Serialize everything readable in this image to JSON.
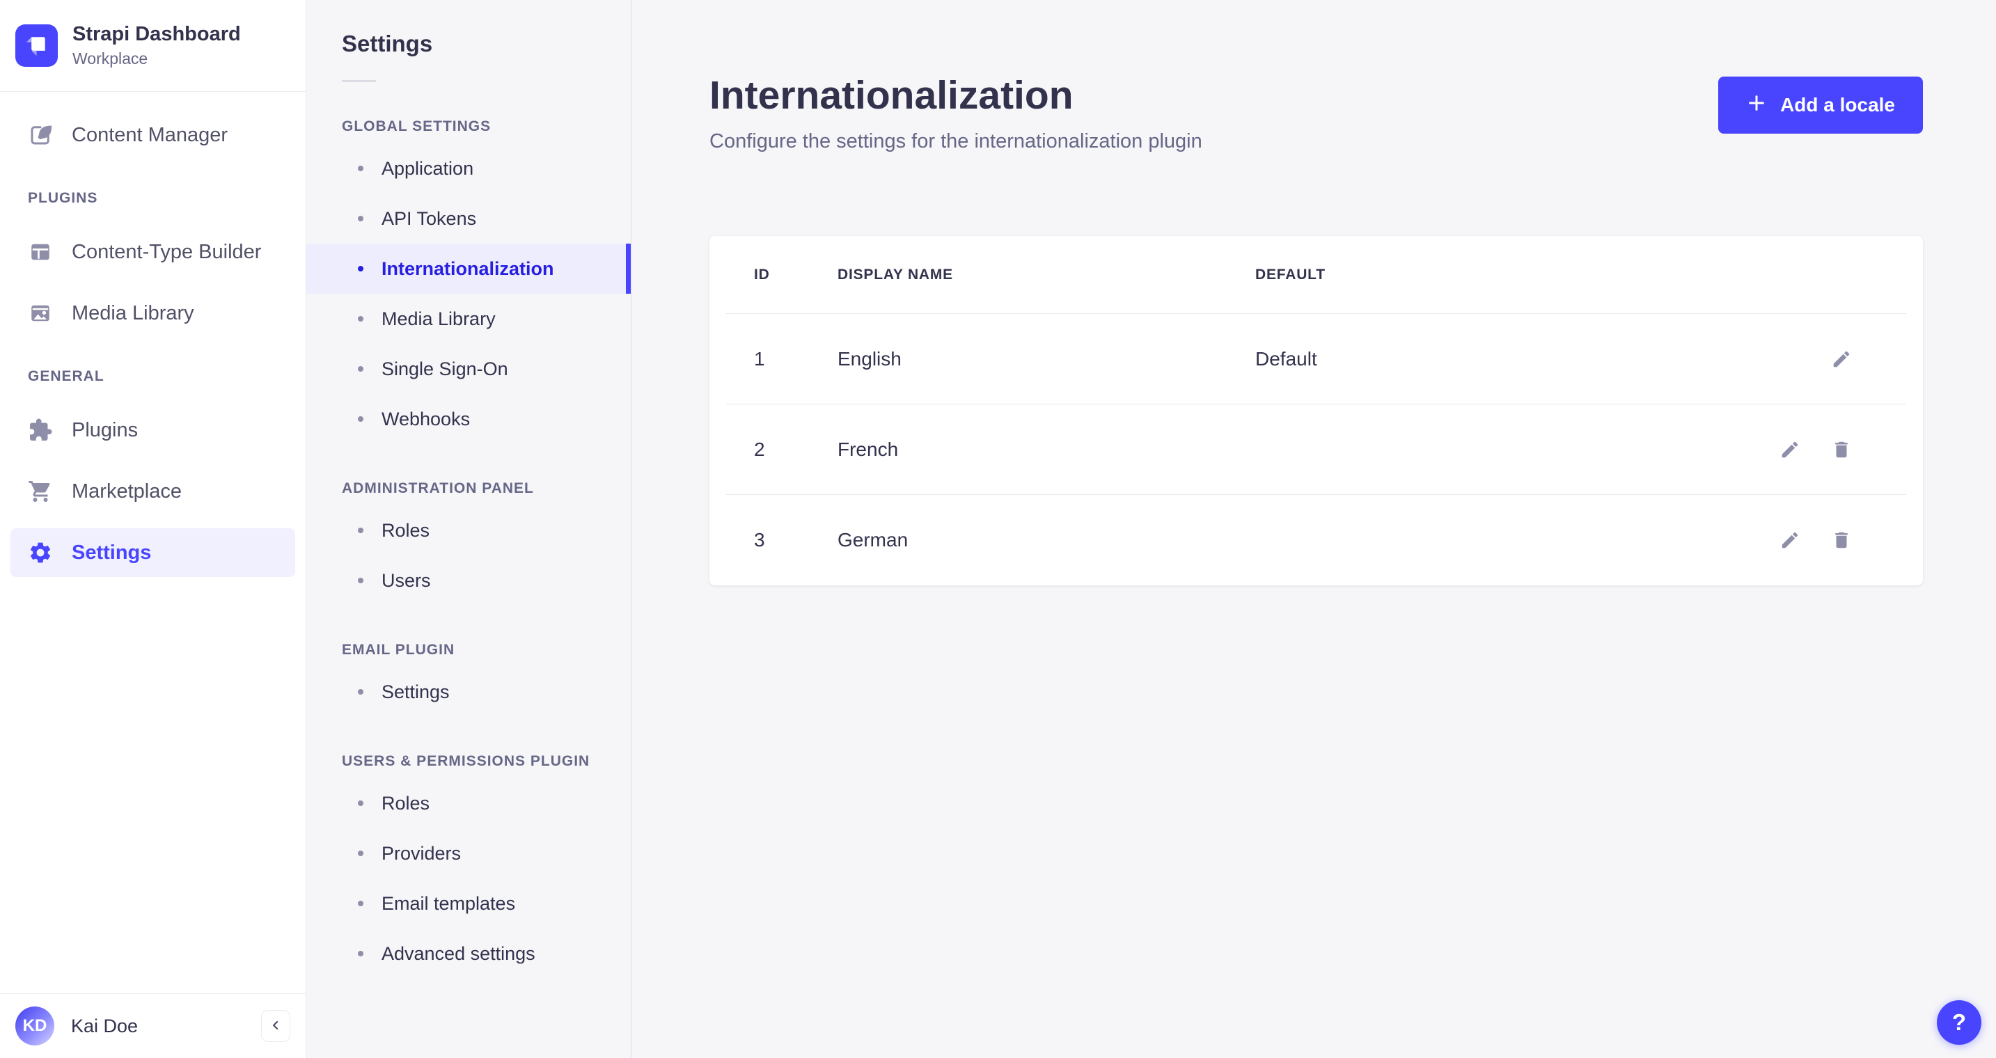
{
  "colors": {
    "accent": "#4945ff",
    "active_link_text": "#271fe0",
    "active_bg": "#ededfe",
    "nav_active_bg": "#f0f0ff",
    "text_dark": "#32324d",
    "text_muted": "#666687",
    "icon_gray": "#8e8ea9",
    "border": "#eaeaef",
    "page_bg": "#f6f6f9",
    "card_bg": "#ffffff"
  },
  "brand": {
    "name": "Strapi Dashboard",
    "workspace": "Workplace"
  },
  "nav": {
    "content_manager": "Content Manager",
    "plugins_section": "PLUGINS",
    "content_type_builder": "Content-Type Builder",
    "media_library": "Media Library",
    "general_section": "GENERAL",
    "plugins": "Plugins",
    "marketplace": "Marketplace",
    "settings": "Settings"
  },
  "user": {
    "name": "Kai Doe",
    "initials": "KD"
  },
  "subnav": {
    "title": "Settings",
    "sections": [
      {
        "label": "GLOBAL SETTINGS",
        "items": [
          {
            "label": "Application"
          },
          {
            "label": "API Tokens"
          },
          {
            "label": "Internationalization",
            "active": true
          },
          {
            "label": "Media Library"
          },
          {
            "label": "Single Sign-On"
          },
          {
            "label": "Webhooks"
          }
        ]
      },
      {
        "label": "ADMINISTRATION PANEL",
        "items": [
          {
            "label": "Roles"
          },
          {
            "label": "Users"
          }
        ]
      },
      {
        "label": "EMAIL PLUGIN",
        "items": [
          {
            "label": "Settings"
          }
        ]
      },
      {
        "label": "USERS & PERMISSIONS PLUGIN",
        "items": [
          {
            "label": "Roles"
          },
          {
            "label": "Providers"
          },
          {
            "label": "Email templates"
          },
          {
            "label": "Advanced settings"
          }
        ]
      }
    ]
  },
  "page": {
    "title": "Internationalization",
    "subtitle": "Configure the settings for the internationalization plugin",
    "add_button": "Add a locale"
  },
  "table": {
    "headers": {
      "id": "ID",
      "display_name": "DISPLAY NAME",
      "default": "DEFAULT"
    },
    "rows": [
      {
        "id": "1",
        "display_name": "English",
        "default": "Default"
      },
      {
        "id": "2",
        "display_name": "French",
        "default": ""
      },
      {
        "id": "3",
        "display_name": "German",
        "default": ""
      }
    ]
  },
  "help": {
    "label": "?"
  }
}
